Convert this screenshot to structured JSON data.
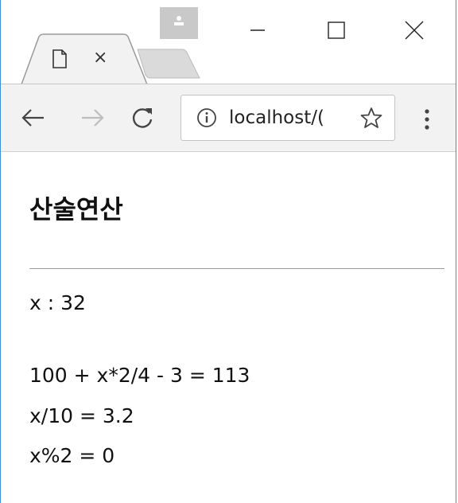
{
  "browser": {
    "tab": {
      "close_glyph": "×",
      "icon": "page-icon"
    },
    "window_controls": [
      "minimize-icon",
      "maximize-icon",
      "close-icon"
    ],
    "toolbar": {
      "icons": [
        "back-arrow-icon",
        "forward-arrow-icon",
        "reload-icon",
        "info-icon",
        "star-icon",
        "menu-icon"
      ],
      "address": "localhost/("
    }
  },
  "page": {
    "title": "산술연산",
    "x_line": "x : 32",
    "results": [
      "100 + x*2/4 - 3 = 113",
      "x/10 = 3.2",
      "x%2 = 0"
    ]
  },
  "colors": {
    "window_border": "#3b8fd8",
    "toolbar_bg": "#f2f2f2",
    "profile_badge": "#c9c9c9",
    "inactive_tab": "#dadada"
  }
}
